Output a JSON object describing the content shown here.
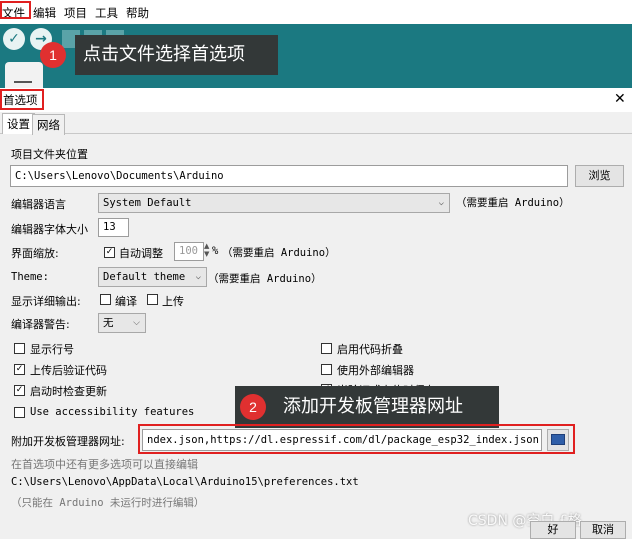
{
  "menu": {
    "file": "文件",
    "edit": "编辑",
    "project": "项目",
    "tools": "工具",
    "help": "帮助"
  },
  "callouts": [
    {
      "num": "1",
      "text": "点击文件选择首选项"
    },
    {
      "num": "2",
      "text": "添加开发板管理器网址"
    }
  ],
  "dialog": {
    "title": "首选项",
    "close": "✕",
    "tabs": [
      "设置",
      "网络"
    ],
    "sketchbook_label": "项目文件夹位置",
    "sketchbook_path": "C:\\Users\\Lenovo\\Documents\\Arduino",
    "browse": "浏览",
    "editor_lang_label": "编辑器语言",
    "editor_lang_value": "System Default",
    "restart_note": "（需要重启 Arduino）",
    "font_size_label": "编辑器字体大小",
    "font_size_value": "13",
    "scale_label": "界面缩放:",
    "scale_auto": "自动调整",
    "scale_value": "100",
    "scale_unit": "%",
    "theme_label": "Theme:",
    "theme_value": "Default theme",
    "verbose_label": "显示详细输出:",
    "verbose_compile": "编译",
    "verbose_upload": "上传",
    "warnings_label": "编译器警告:",
    "warnings_value": "无",
    "opt_line_numbers": "显示行号",
    "opt_verify_upload": "上传后验证代码",
    "opt_check_updates": "启动时检查更新",
    "opt_accessibility": "Use accessibility features",
    "opt_code_folding": "启用代码折叠",
    "opt_external_editor": "使用外部编辑器",
    "opt_save_on_verify": "当验证或上传时保存",
    "boards_url_label": "附加开发板管理器网址:",
    "boards_url_value": "ndex.json,https://dl.espressif.com/dl/package_esp32_index.json",
    "more_prefs": "在首选项中还有更多选项可以直接编辑",
    "prefs_path": "C:\\Users\\Lenovo\\AppData\\Local\\Arduino15\\preferences.txt",
    "edit_note": "（只能在 Arduino 未运行时进行编辑）",
    "ok": "好",
    "cancel": "取消"
  },
  "watermark": "CSDN @空白 £格",
  "colors": {
    "toolbar": "#1b7981",
    "annotation_red": "#e02020",
    "callout_bg": "#333838"
  }
}
